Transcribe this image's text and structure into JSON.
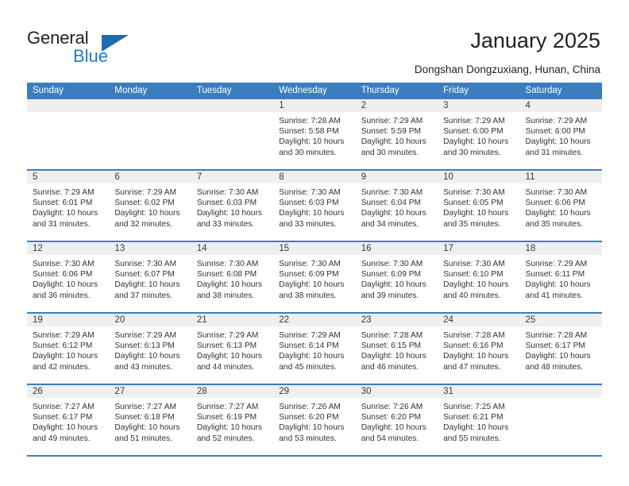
{
  "brand": {
    "line1": "General",
    "line2": "Blue",
    "triangle_color": "#1b6cb0",
    "line2_color": "#1f7bc1"
  },
  "header": {
    "title": "January 2025",
    "subtitle": "Dongshan Dongzuxiang, Hunan, China"
  },
  "colors": {
    "header_row_bg": "#3b7ebf",
    "day_band_bg": "#efefef",
    "week_divider": "#3b7ebf",
    "text": "#333333"
  },
  "calendar": {
    "day_headers": [
      "Sunday",
      "Monday",
      "Tuesday",
      "Wednesday",
      "Thursday",
      "Friday",
      "Saturday"
    ],
    "weeks": [
      [
        {
          "day": "",
          "empty": true
        },
        {
          "day": "",
          "empty": true
        },
        {
          "day": "",
          "empty": true
        },
        {
          "day": "1",
          "sunrise": "Sunrise: 7:28 AM",
          "sunset": "Sunset: 5:58 PM",
          "daylight": "Daylight: 10 hours and 30 minutes."
        },
        {
          "day": "2",
          "sunrise": "Sunrise: 7:29 AM",
          "sunset": "Sunset: 5:59 PM",
          "daylight": "Daylight: 10 hours and 30 minutes."
        },
        {
          "day": "3",
          "sunrise": "Sunrise: 7:29 AM",
          "sunset": "Sunset: 6:00 PM",
          "daylight": "Daylight: 10 hours and 30 minutes."
        },
        {
          "day": "4",
          "sunrise": "Sunrise: 7:29 AM",
          "sunset": "Sunset: 6:00 PM",
          "daylight": "Daylight: 10 hours and 31 minutes."
        }
      ],
      [
        {
          "day": "5",
          "sunrise": "Sunrise: 7:29 AM",
          "sunset": "Sunset: 6:01 PM",
          "daylight": "Daylight: 10 hours and 31 minutes."
        },
        {
          "day": "6",
          "sunrise": "Sunrise: 7:29 AM",
          "sunset": "Sunset: 6:02 PM",
          "daylight": "Daylight: 10 hours and 32 minutes."
        },
        {
          "day": "7",
          "sunrise": "Sunrise: 7:30 AM",
          "sunset": "Sunset: 6:03 PM",
          "daylight": "Daylight: 10 hours and 33 minutes."
        },
        {
          "day": "8",
          "sunrise": "Sunrise: 7:30 AM",
          "sunset": "Sunset: 6:03 PM",
          "daylight": "Daylight: 10 hours and 33 minutes."
        },
        {
          "day": "9",
          "sunrise": "Sunrise: 7:30 AM",
          "sunset": "Sunset: 6:04 PM",
          "daylight": "Daylight: 10 hours and 34 minutes."
        },
        {
          "day": "10",
          "sunrise": "Sunrise: 7:30 AM",
          "sunset": "Sunset: 6:05 PM",
          "daylight": "Daylight: 10 hours and 35 minutes."
        },
        {
          "day": "11",
          "sunrise": "Sunrise: 7:30 AM",
          "sunset": "Sunset: 6:06 PM",
          "daylight": "Daylight: 10 hours and 35 minutes."
        }
      ],
      [
        {
          "day": "12",
          "sunrise": "Sunrise: 7:30 AM",
          "sunset": "Sunset: 6:06 PM",
          "daylight": "Daylight: 10 hours and 36 minutes."
        },
        {
          "day": "13",
          "sunrise": "Sunrise: 7:30 AM",
          "sunset": "Sunset: 6:07 PM",
          "daylight": "Daylight: 10 hours and 37 minutes."
        },
        {
          "day": "14",
          "sunrise": "Sunrise: 7:30 AM",
          "sunset": "Sunset: 6:08 PM",
          "daylight": "Daylight: 10 hours and 38 minutes."
        },
        {
          "day": "15",
          "sunrise": "Sunrise: 7:30 AM",
          "sunset": "Sunset: 6:09 PM",
          "daylight": "Daylight: 10 hours and 38 minutes."
        },
        {
          "day": "16",
          "sunrise": "Sunrise: 7:30 AM",
          "sunset": "Sunset: 6:09 PM",
          "daylight": "Daylight: 10 hours and 39 minutes."
        },
        {
          "day": "17",
          "sunrise": "Sunrise: 7:30 AM",
          "sunset": "Sunset: 6:10 PM",
          "daylight": "Daylight: 10 hours and 40 minutes."
        },
        {
          "day": "18",
          "sunrise": "Sunrise: 7:29 AM",
          "sunset": "Sunset: 6:11 PM",
          "daylight": "Daylight: 10 hours and 41 minutes."
        }
      ],
      [
        {
          "day": "19",
          "sunrise": "Sunrise: 7:29 AM",
          "sunset": "Sunset: 6:12 PM",
          "daylight": "Daylight: 10 hours and 42 minutes."
        },
        {
          "day": "20",
          "sunrise": "Sunrise: 7:29 AM",
          "sunset": "Sunset: 6:13 PM",
          "daylight": "Daylight: 10 hours and 43 minutes."
        },
        {
          "day": "21",
          "sunrise": "Sunrise: 7:29 AM",
          "sunset": "Sunset: 6:13 PM",
          "daylight": "Daylight: 10 hours and 44 minutes."
        },
        {
          "day": "22",
          "sunrise": "Sunrise: 7:29 AM",
          "sunset": "Sunset: 6:14 PM",
          "daylight": "Daylight: 10 hours and 45 minutes."
        },
        {
          "day": "23",
          "sunrise": "Sunrise: 7:28 AM",
          "sunset": "Sunset: 6:15 PM",
          "daylight": "Daylight: 10 hours and 46 minutes."
        },
        {
          "day": "24",
          "sunrise": "Sunrise: 7:28 AM",
          "sunset": "Sunset: 6:16 PM",
          "daylight": "Daylight: 10 hours and 47 minutes."
        },
        {
          "day": "25",
          "sunrise": "Sunrise: 7:28 AM",
          "sunset": "Sunset: 6:17 PM",
          "daylight": "Daylight: 10 hours and 48 minutes."
        }
      ],
      [
        {
          "day": "26",
          "sunrise": "Sunrise: 7:27 AM",
          "sunset": "Sunset: 6:17 PM",
          "daylight": "Daylight: 10 hours and 49 minutes."
        },
        {
          "day": "27",
          "sunrise": "Sunrise: 7:27 AM",
          "sunset": "Sunset: 6:18 PM",
          "daylight": "Daylight: 10 hours and 51 minutes."
        },
        {
          "day": "28",
          "sunrise": "Sunrise: 7:27 AM",
          "sunset": "Sunset: 6:19 PM",
          "daylight": "Daylight: 10 hours and 52 minutes."
        },
        {
          "day": "29",
          "sunrise": "Sunrise: 7:26 AM",
          "sunset": "Sunset: 6:20 PM",
          "daylight": "Daylight: 10 hours and 53 minutes."
        },
        {
          "day": "30",
          "sunrise": "Sunrise: 7:26 AM",
          "sunset": "Sunset: 6:20 PM",
          "daylight": "Daylight: 10 hours and 54 minutes."
        },
        {
          "day": "31",
          "sunrise": "Sunrise: 7:25 AM",
          "sunset": "Sunset: 6:21 PM",
          "daylight": "Daylight: 10 hours and 55 minutes."
        },
        {
          "day": "",
          "empty": true
        }
      ]
    ]
  }
}
